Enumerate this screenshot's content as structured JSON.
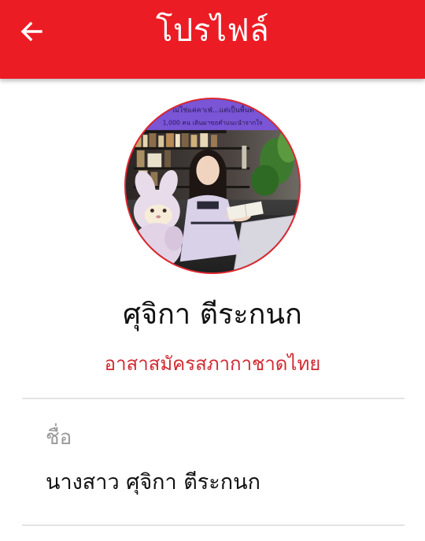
{
  "header": {
    "title": "โปรไฟล์",
    "back_icon": "arrow-left-icon",
    "background_color": "#ec1c24"
  },
  "avatar": {
    "banner_text_line1": "ไม่ใช่แค่คาเฟ่…แต่เป็นพื้นที่",
    "banner_text_line2": "1,000 คน เดินมาขอคำแนะนำจากใจ",
    "border_color": "#e0262e"
  },
  "profile": {
    "name": "ศุจิกา ตีระกนก",
    "role": "อาสาสมัครสภากาชาดไทย",
    "role_color": "#d12a33"
  },
  "fields": [
    {
      "label": "ชื่อ",
      "value": "นางสาว ศุจิกา ตีระกนก"
    }
  ]
}
